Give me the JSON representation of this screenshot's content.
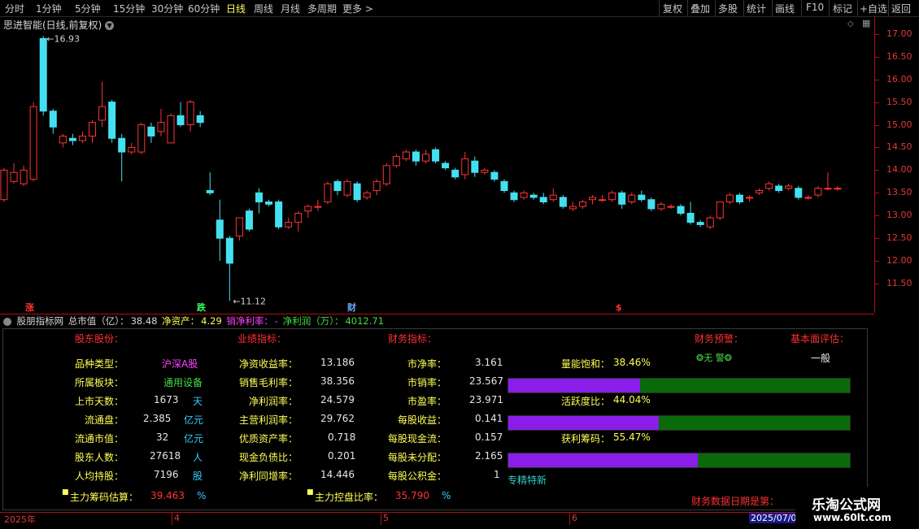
{
  "toolbar": {
    "periods": [
      "分时",
      "1分钟",
      "5分钟",
      "15分钟",
      "30分钟",
      "60分钟",
      "日线",
      "周线",
      "月线",
      "多周期",
      "更多 >"
    ],
    "active_period": "日线",
    "actions": [
      "复权",
      "叠加",
      "多股",
      "统计",
      "画线",
      "F10",
      "标记",
      "+自选",
      "返回"
    ]
  },
  "stock": {
    "title": "思进智能(日线,前复权)"
  },
  "chart_data": {
    "type": "candlestick",
    "ylim": [
      11.0,
      17.3
    ],
    "y_ticks": [
      "17.00",
      "16.50",
      "16.00",
      "15.50",
      "15.00",
      "14.50",
      "14.00",
      "13.50",
      "13.00",
      "12.50",
      "12.00",
      "11.50"
    ],
    "high_label": "16.93",
    "low_label": "11.12",
    "markers": [
      {
        "text": "涨",
        "color": "#ff3333"
      },
      {
        "text": "跌",
        "color": "#33ff66"
      },
      {
        "text": "财",
        "color": "#66aaff"
      },
      {
        "text": "$",
        "color": "#ff3333"
      }
    ],
    "candles": [
      [
        13.35,
        14.0,
        13.3,
        14.05
      ],
      [
        13.75,
        13.95,
        13.7,
        14.15
      ],
      [
        13.7,
        14.0,
        13.65,
        14.1
      ],
      [
        13.8,
        15.4,
        13.75,
        15.5
      ],
      [
        16.9,
        15.3,
        15.2,
        16.95
      ],
      [
        15.3,
        14.95,
        14.8,
        15.35
      ],
      [
        14.6,
        14.75,
        14.5,
        14.8
      ],
      [
        14.7,
        14.65,
        14.55,
        14.8
      ],
      [
        14.65,
        14.75,
        14.6,
        14.85
      ],
      [
        14.75,
        15.05,
        14.6,
        15.1
      ],
      [
        15.1,
        15.4,
        14.95,
        15.95
      ],
      [
        15.5,
        14.7,
        14.6,
        15.55
      ],
      [
        14.7,
        14.4,
        13.75,
        14.8
      ],
      [
        14.4,
        14.5,
        14.35,
        14.6
      ],
      [
        14.4,
        15.0,
        14.35,
        15.05
      ],
      [
        14.95,
        14.75,
        14.6,
        15.05
      ],
      [
        14.85,
        15.05,
        14.75,
        15.35
      ],
      [
        14.6,
        15.2,
        14.6,
        15.25
      ],
      [
        15.2,
        15.0,
        14.95,
        15.5
      ],
      [
        15.0,
        15.5,
        14.85,
        15.55
      ],
      [
        15.2,
        15.05,
        14.95,
        15.3
      ],
      [
        13.55,
        13.5,
        13.45,
        13.95
      ],
      [
        12.9,
        12.5,
        12.0,
        13.35
      ],
      [
        12.5,
        11.95,
        11.12,
        12.55
      ],
      [
        12.55,
        12.95,
        12.45,
        12.95
      ],
      [
        13.1,
        12.7,
        12.65,
        13.15
      ],
      [
        13.5,
        13.3,
        13.05,
        13.6
      ],
      [
        13.3,
        13.25,
        13.2,
        13.35
      ],
      [
        13.3,
        12.75,
        12.7,
        13.35
      ],
      [
        12.75,
        12.85,
        12.7,
        12.95
      ],
      [
        12.85,
        13.05,
        12.65,
        13.1
      ],
      [
        13.1,
        13.2,
        12.95,
        13.25
      ],
      [
        13.2,
        13.2,
        13.1,
        13.35
      ],
      [
        13.3,
        13.7,
        13.25,
        13.75
      ],
      [
        13.75,
        13.55,
        13.45,
        13.8
      ],
      [
        13.45,
        13.75,
        13.4,
        13.8
      ],
      [
        13.7,
        13.35,
        13.3,
        13.75
      ],
      [
        13.4,
        13.5,
        13.35,
        13.55
      ],
      [
        13.55,
        13.75,
        13.45,
        13.8
      ],
      [
        13.7,
        14.1,
        13.65,
        14.15
      ],
      [
        14.1,
        14.3,
        14.05,
        14.35
      ],
      [
        14.25,
        14.4,
        14.2,
        14.45
      ],
      [
        14.4,
        14.2,
        14.1,
        14.45
      ],
      [
        14.2,
        14.35,
        14.15,
        14.45
      ],
      [
        14.45,
        14.2,
        14.15,
        14.5
      ],
      [
        14.15,
        14.05,
        14.0,
        14.2
      ],
      [
        14.0,
        13.85,
        13.8,
        14.05
      ],
      [
        13.9,
        14.25,
        13.8,
        14.4
      ],
      [
        14.2,
        13.95,
        13.85,
        14.3
      ],
      [
        13.95,
        14.0,
        13.9,
        14.05
      ],
      [
        13.95,
        13.8,
        13.75,
        14.0
      ],
      [
        13.75,
        13.55,
        13.5,
        13.8
      ],
      [
        13.5,
        13.35,
        13.3,
        13.55
      ],
      [
        13.4,
        13.5,
        13.35,
        13.55
      ],
      [
        13.45,
        13.4,
        13.35,
        13.5
      ],
      [
        13.4,
        13.3,
        13.25,
        13.5
      ],
      [
        13.35,
        13.45,
        13.3,
        13.6
      ],
      [
        13.4,
        13.2,
        13.15,
        13.45
      ],
      [
        13.15,
        13.2,
        13.1,
        13.3
      ],
      [
        13.2,
        13.3,
        13.15,
        13.35
      ],
      [
        13.35,
        13.4,
        13.25,
        13.45
      ],
      [
        13.35,
        13.35,
        13.3,
        13.45
      ],
      [
        13.35,
        13.5,
        13.3,
        13.55
      ],
      [
        13.5,
        13.25,
        13.15,
        13.55
      ],
      [
        13.3,
        13.45,
        13.25,
        13.5
      ],
      [
        13.45,
        13.35,
        13.3,
        13.55
      ],
      [
        13.35,
        13.15,
        13.1,
        13.4
      ],
      [
        13.15,
        13.25,
        13.1,
        13.3
      ],
      [
        13.2,
        13.2,
        13.15,
        13.25
      ],
      [
        13.2,
        13.05,
        13.0,
        13.25
      ],
      [
        13.05,
        12.85,
        12.8,
        13.3
      ],
      [
        12.85,
        12.8,
        12.75,
        12.9
      ],
      [
        12.75,
        12.95,
        12.7,
        13.0
      ],
      [
        12.95,
        13.3,
        12.9,
        13.3
      ],
      [
        13.3,
        13.45,
        13.25,
        13.5
      ],
      [
        13.45,
        13.3,
        13.25,
        13.5
      ],
      [
        13.4,
        13.4,
        13.3,
        13.45
      ],
      [
        13.5,
        13.55,
        13.45,
        13.6
      ],
      [
        13.6,
        13.7,
        13.55,
        13.75
      ],
      [
        13.65,
        13.55,
        13.5,
        13.7
      ],
      [
        13.6,
        13.65,
        13.55,
        13.7
      ],
      [
        13.6,
        13.4,
        13.35,
        13.65
      ],
      [
        13.4,
        13.4,
        13.35,
        13.45
      ],
      [
        13.45,
        13.6,
        13.4,
        13.65
      ],
      [
        13.6,
        13.6,
        13.55,
        13.95
      ],
      [
        13.6,
        13.6,
        13.55,
        13.65
      ]
    ]
  },
  "indicator": {
    "name": "股朋指标网",
    "total_cap_label": "总市值（亿）：",
    "total_cap_value": "38.48",
    "net_asset_label": "净资产：",
    "net_asset_value": "4.29",
    "margin_label": "销净利率：",
    "margin_value": "-",
    "profit_label": "净利润（万）：",
    "profit_value": "4012.71"
  },
  "panel": {
    "sections": {
      "holders": "股东股份：",
      "performance": "业绩指标：",
      "finance": "财务指标：",
      "warning": "财务预警：",
      "basic": "基本面评估："
    },
    "col1": [
      {
        "label": "品种类型：",
        "value": "沪深A股",
        "unit": ""
      },
      {
        "label": "所属板块：",
        "value": "通用设备",
        "unit": ""
      },
      {
        "label": "上市天数：",
        "value": "1673",
        "unit": "天"
      },
      {
        "label": "流通盘：",
        "value": "2.385",
        "unit": "亿元"
      },
      {
        "label": "流通市值：",
        "value": "32",
        "unit": "亿元"
      },
      {
        "label": "股东人数：",
        "value": "27618",
        "unit": "人"
      },
      {
        "label": "人均持股：",
        "value": "7196",
        "unit": "股"
      }
    ],
    "col2": [
      {
        "label": "净资收益率：",
        "value": "13.186"
      },
      {
        "label": "销售毛利率：",
        "value": "38.356"
      },
      {
        "label": "净利润率：",
        "value": "24.579"
      },
      {
        "label": "主营利润率：",
        "value": "29.762"
      },
      {
        "label": "优质资产率：",
        "value": "0.718"
      },
      {
        "label": "现金负债比：",
        "value": "0.201"
      },
      {
        "label": "净利同增率：",
        "value": "14.446"
      }
    ],
    "col3": [
      {
        "label": "市净率：",
        "value": "3.161"
      },
      {
        "label": "市销率：",
        "value": "23.567"
      },
      {
        "label": "市盈率：",
        "value": "23.971"
      },
      {
        "label": "每股收益：",
        "value": "0.141"
      },
      {
        "label": "每股现金流：",
        "value": "0.157"
      },
      {
        "label": "每股未分配：",
        "value": "2.165"
      },
      {
        "label": "每股公积金：",
        "value": "1"
      }
    ],
    "warning_value": "无 警",
    "basic_value": "一般",
    "bars": [
      {
        "label": "量能饱和：",
        "value": "38.46%",
        "fraction": 0.3846
      },
      {
        "label": "活跃度比：",
        "value": "44.04%",
        "fraction": 0.4404
      },
      {
        "label": "获利筹码：",
        "value": "55.47%",
        "fraction": 0.5547
      }
    ],
    "special": "专精特新",
    "chip_label": "主力筹码估算：",
    "chip_value": "39.463",
    "chip_unit": "%",
    "control_label": "主力控盘比率：",
    "control_value": "35.790",
    "control_unit": "%",
    "report_date_label": "财务数据日期是第："
  },
  "date_axis": {
    "labels": [
      "2025年",
      "4",
      "5",
      "6",
      "2025/07/0"
    ]
  },
  "watermark": {
    "title": "乐淘公式网",
    "url": "www.60lt.com"
  },
  "colors": {
    "up": "#ff3333",
    "down": "#44e0f0",
    "axis": "#b01010",
    "bar_fill": "#8a1ee8",
    "bar_bg": "#0a6a0a"
  }
}
